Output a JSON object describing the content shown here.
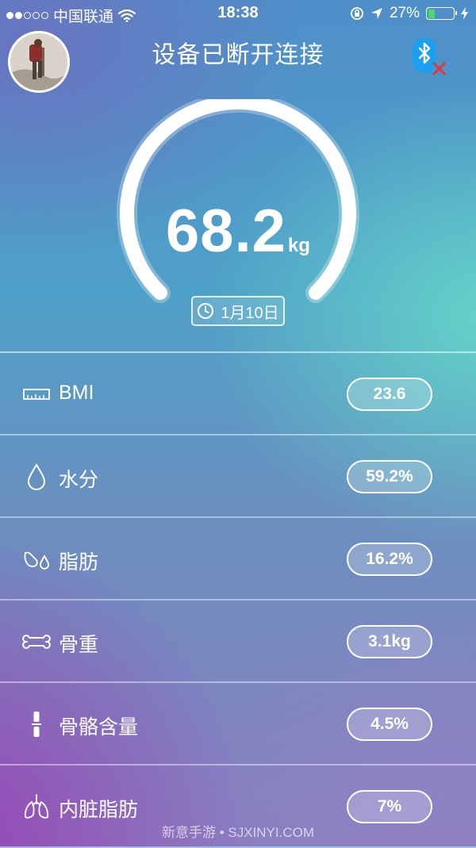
{
  "status_bar": {
    "carrier": "中国联通",
    "time": "18:38",
    "battery_percent": "27%",
    "battery_level": 0.27,
    "battery_color": "#4cd964"
  },
  "header": {
    "title": "设备已断开连接",
    "bluetooth_icon": "bluetooth-disconnected-icon",
    "bluetooth_color": "#1aa0ef",
    "disconnect_color": "#e8363c"
  },
  "gauge": {
    "weight_value": "68.2",
    "weight_unit": "kg",
    "date": "1月10日"
  },
  "metrics": [
    {
      "icon": "ruler-icon",
      "label": "BMI",
      "value": "23.6"
    },
    {
      "icon": "water-drop-icon",
      "label": "水分",
      "value": "59.2%"
    },
    {
      "icon": "fat-drops-icon",
      "label": "脂肪",
      "value": "16.2%"
    },
    {
      "icon": "bone-icon",
      "label": "骨重",
      "value": "3.1kg"
    },
    {
      "icon": "skeleton-icon",
      "label": "骨骼含量",
      "value": "4.5%"
    },
    {
      "icon": "lungs-icon",
      "label": "内脏脂肪",
      "value": "7%"
    }
  ],
  "watermark": "新意手游 • SJXINYI.COM"
}
